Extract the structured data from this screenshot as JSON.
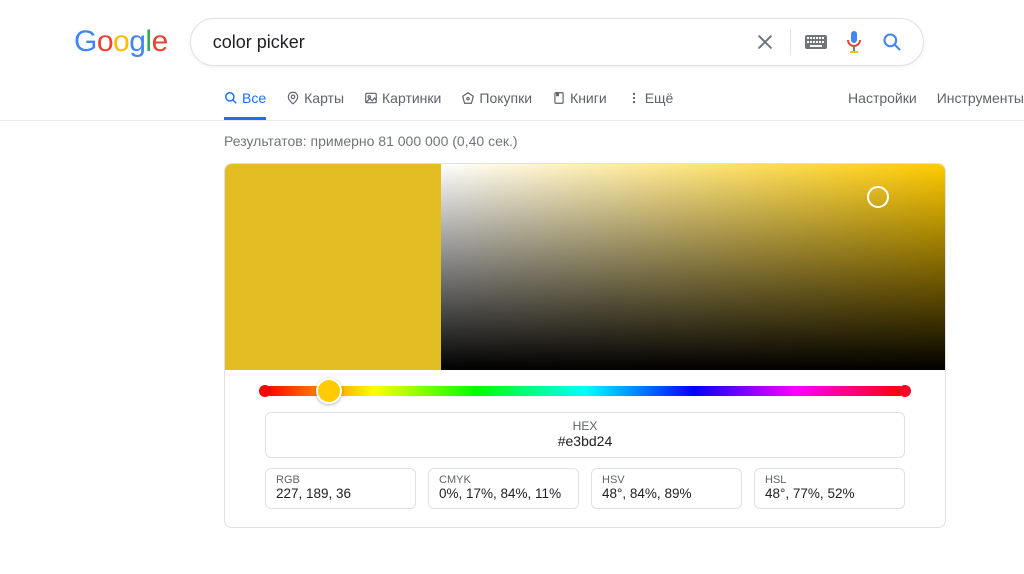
{
  "logo_text": "Google",
  "search": {
    "value": "color picker",
    "placeholder": ""
  },
  "tabs": {
    "all": "Все",
    "maps": "Карты",
    "images": "Картинки",
    "shopping": "Покупки",
    "books": "Книги",
    "more": "Ещё",
    "settings": "Настройки",
    "tools": "Инструменты"
  },
  "results_line": "Результатов: примерно 81 000 000 (0,40 сек.)",
  "picker": {
    "swatch_color": "#e3bd24",
    "hex_label": "HEX",
    "hex_value": "#e3bd24",
    "rgb_label": "RGB",
    "rgb_value": "227, 189, 36",
    "cmyk_label": "CMYK",
    "cmyk_value": "0%, 17%, 84%, 11%",
    "hsv_label": "HSV",
    "hsv_value": "48°, 84%, 89%",
    "hsl_label": "HSL",
    "hsl_value": "48°, 77%, 52%"
  }
}
